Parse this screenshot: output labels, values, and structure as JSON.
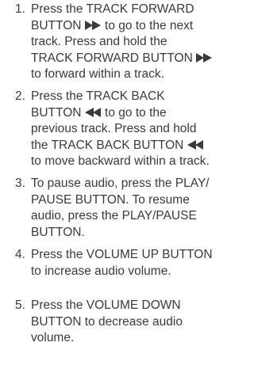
{
  "steps": [
    {
      "number": "1.",
      "lines": [
        {
          "text": "Press the TRACK FORWARD"
        },
        {
          "text": "BUTTON ",
          "icon": "track-forward-icon",
          "after": " to go to the next"
        },
        {
          "text": "track.  Press and hold the"
        },
        {
          "text": "TRACK FORWARD BUTTON ",
          "icon": "track-forward-icon",
          "after": ""
        },
        {
          "text": "to forward within a track."
        }
      ]
    },
    {
      "number": "2.",
      "lines": [
        {
          "text": "Press the TRACK BACK"
        },
        {
          "text": "BUTTON ",
          "icon": "track-back-icon",
          "after": " to go to the"
        },
        {
          "text": "previous track.  Press and hold"
        },
        {
          "text": "the TRACK BACK BUTTON ",
          "icon": "track-back-icon",
          "after": ""
        },
        {
          "text": "to move backward within a track."
        }
      ]
    },
    {
      "number": "3.",
      "lines": [
        {
          "text": "To pause audio, press the PLAY/"
        },
        {
          "text": "PAUSE BUTTON.  To resume"
        },
        {
          "text": "audio, press the PLAY/PAUSE"
        },
        {
          "text": "BUTTON."
        }
      ]
    },
    {
      "number": "4.",
      "lines": [
        {
          "text": "Press the VOLUME UP BUTTON"
        },
        {
          "text": "to increase audio volume."
        }
      ]
    },
    {
      "number": "5.",
      "lines": [
        {
          "text": "Press the VOLUME DOWN"
        },
        {
          "text": "BUTTON to decrease audio"
        },
        {
          "text": "volume."
        }
      ]
    }
  ]
}
